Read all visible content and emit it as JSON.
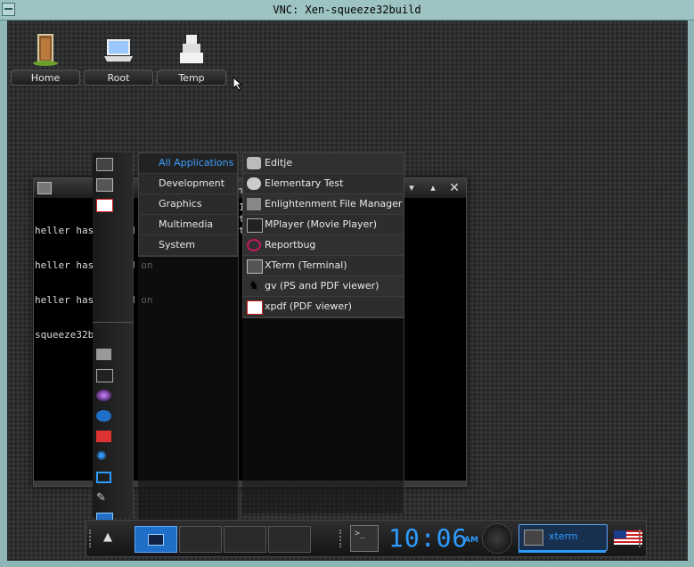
{
  "vnc": {
    "title": "VNC: Xen-squeeze32build"
  },
  "desktop_icons": [
    {
      "label": "Home",
      "icon": "door-icon"
    },
    {
      "label": "Root",
      "icon": "laptop-icon"
    },
    {
      "label": "Temp",
      "icon": "boxes-icon"
    }
  ],
  "terminal": {
    "lines": [
      "heller has logged on",
      "heller has logged on",
      "heller has logged on",
      "squeeze32build%"
    ],
    "overflow_chars": [
      "n",
      "1",
      "t",
      "t"
    ]
  },
  "menu": {
    "categories": [
      {
        "label": "All Applications",
        "selected": true
      },
      {
        "label": "Development",
        "selected": false
      },
      {
        "label": "Graphics",
        "selected": false
      },
      {
        "label": "Multimedia",
        "selected": false
      },
      {
        "label": "System",
        "selected": false
      }
    ],
    "apps": [
      {
        "label": "Editje",
        "icon": "editje-icon"
      },
      {
        "label": "Elementary Test",
        "icon": "elementary-icon"
      },
      {
        "label": "Enlightenment File Manager",
        "icon": "file-manager-icon"
      },
      {
        "label": "MPlayer (Movie Player)",
        "icon": "mplayer-icon"
      },
      {
        "label": "Reportbug",
        "icon": "reportbug-icon"
      },
      {
        "label": "XTerm (Terminal)",
        "icon": "xterm-icon"
      },
      {
        "label": "gv (PS and PDF viewer)",
        "icon": "gv-icon"
      },
      {
        "label": "xpdf (PDF viewer)",
        "icon": "xpdf-icon"
      }
    ],
    "left_column_icons": [
      "terminal-icon",
      "terminal-icon",
      "pdf-icon",
      "folder-icon",
      "terminal-small-icon",
      "media-icon",
      "globe-icon",
      "package-icon",
      "settings-icon",
      "logout-icon",
      "tools-icon",
      "network-icon"
    ]
  },
  "shelf": {
    "clock_time": "10:06",
    "clock_ampm": "AM",
    "task_label": "xterm",
    "accent_color": "#2e9bff"
  }
}
